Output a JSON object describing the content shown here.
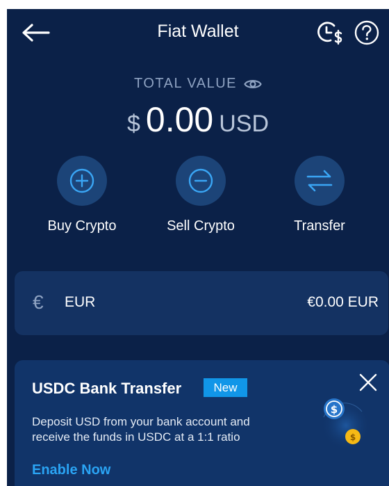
{
  "header": {
    "title": "Fiat Wallet",
    "back_icon": "arrow-left-icon",
    "history_icon": "clock-dollar-icon",
    "help_icon": "question-circle-icon"
  },
  "total": {
    "label": "TOTAL VALUE",
    "visibility_icon": "eye-icon",
    "currency_symbol": "$",
    "amount": "0.00",
    "currency_code": "USD"
  },
  "actions": [
    {
      "label": "Buy Crypto",
      "icon": "plus-circle-icon"
    },
    {
      "label": "Sell Crypto",
      "icon": "minus-circle-icon"
    },
    {
      "label": "Transfer",
      "icon": "swap-arrows-icon"
    }
  ],
  "wallets": [
    {
      "icon": "euro-icon",
      "symbol": "€",
      "code": "EUR",
      "balance": "€0.00 EUR"
    }
  ],
  "promo": {
    "title": "USDC Bank Transfer",
    "badge": "New",
    "description_line1": "Deposit USD from your bank account and",
    "description_line2": "receive the funds in USDC at a 1:1 ratio",
    "cta": "Enable Now",
    "close_icon": "close-icon",
    "illustration": "usdc-coins-icon"
  },
  "colors": {
    "background": "#0b2148",
    "card": "#143262",
    "promo_card": "#113469",
    "accent": "#2aa4f4",
    "badge": "#1196e8",
    "muted_text": "#8fa3c2"
  }
}
